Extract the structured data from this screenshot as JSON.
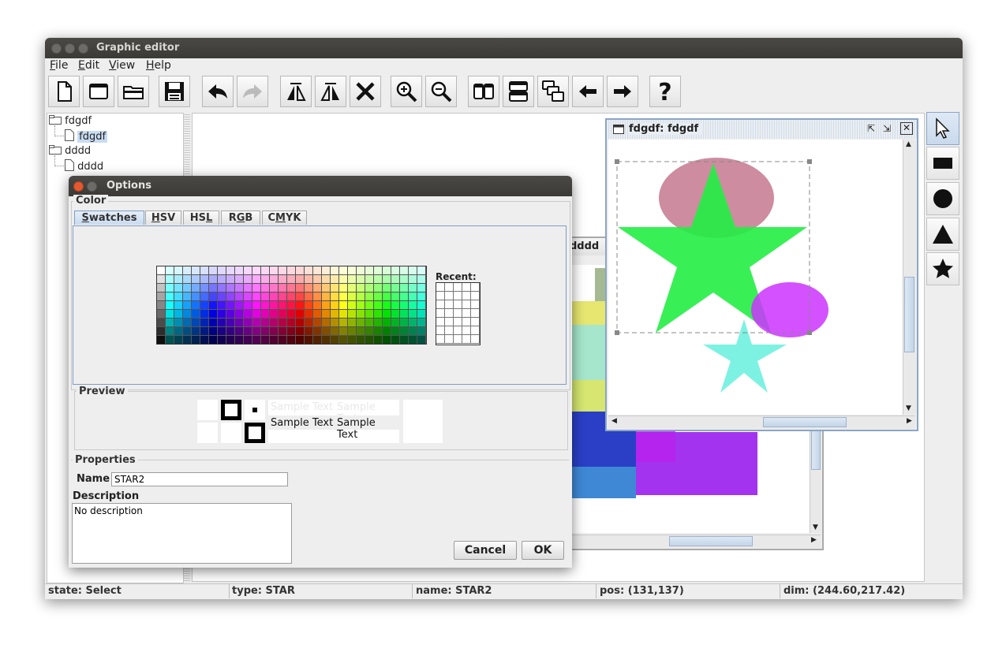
{
  "window": {
    "title": "Graphic editor",
    "menu": [
      {
        "label": "File",
        "underline": "F",
        "rest": "ile"
      },
      {
        "label": "Edit",
        "underline": "E",
        "rest": "dit"
      },
      {
        "label": "View",
        "underline": "V",
        "rest": "iew"
      },
      {
        "label": "Help",
        "underline": "H",
        "rest": "elp"
      }
    ]
  },
  "toolbar": {
    "buttons": [
      "new-document-icon",
      "new-window-icon",
      "open-folder-icon",
      "save-icon",
      "undo-icon",
      "redo-icon",
      "flip-horizontal-icon",
      "flip-vertical-icon",
      "delete-icon",
      "zoom-in-icon",
      "zoom-out-icon",
      "tile-vertical-icon",
      "tile-horizontal-icon",
      "cascade-icon",
      "arrow-left-icon",
      "arrow-right-icon",
      "help-icon"
    ]
  },
  "tree": {
    "items": [
      {
        "label": "fdgdf",
        "kind": "folder"
      },
      {
        "label": "fdgdf",
        "kind": "document",
        "selected": true
      },
      {
        "label": "dddd",
        "kind": "folder"
      },
      {
        "label": "dddd",
        "kind": "document"
      }
    ]
  },
  "internal_frames": {
    "back_title": "dddd",
    "front_title": "fdgdf: fdgdf"
  },
  "tools": [
    "pointer-icon",
    "rectangle-icon",
    "circle-icon",
    "triangle-icon",
    "star-icon"
  ],
  "dialog": {
    "title": "Options",
    "color_group": "Color",
    "tabs": [
      {
        "label": "Swatches",
        "pre": "",
        "u": "S",
        "post": "watches",
        "selected": true
      },
      {
        "label": "HSV",
        "pre": "",
        "u": "H",
        "post": "SV"
      },
      {
        "label": "HSL",
        "pre": "HS",
        "u": "L",
        "post": ""
      },
      {
        "label": "RGB",
        "pre": "R",
        "u": "G",
        "post": "B"
      },
      {
        "label": "CMYK",
        "pre": "C",
        "u": "M",
        "post": "YK"
      }
    ],
    "recent_label": "Recent:",
    "preview_group": "Preview",
    "sample_text": "Sample Text",
    "properties_group": "Properties",
    "name_label": "Name",
    "name_value": "STAR2",
    "description_label": "Description",
    "description_value": "No description",
    "cancel_label": "Cancel",
    "ok_label": "OK"
  },
  "status": {
    "state": "state: Select",
    "type": "type: STAR",
    "name": "name: STAR2",
    "pos": "pos: (131,137)",
    "dim": "dim: (244.60,217.42)"
  },
  "colors": {
    "star_green": "#22ee44",
    "ellipse_rose": "#c4788e",
    "ellipse_magenta": "#cc33ff",
    "star_cyan": "#66f0dd",
    "selection": "#7da2ce"
  }
}
